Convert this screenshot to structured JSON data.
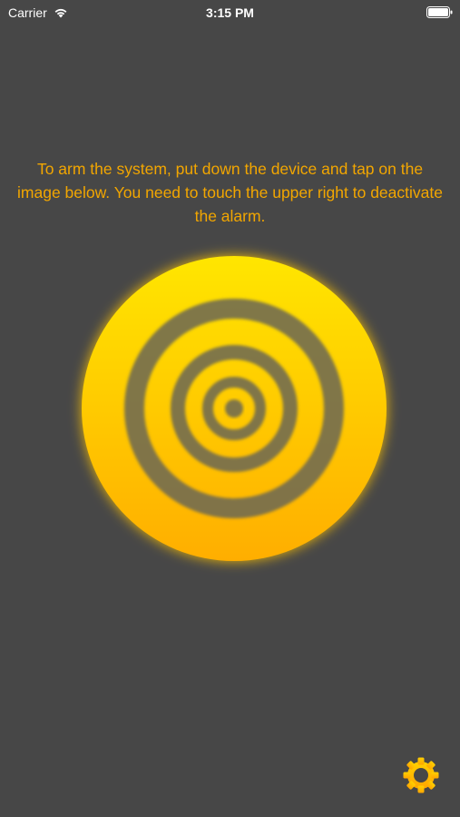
{
  "status_bar": {
    "carrier": "Carrier",
    "time": "3:15 PM",
    "wifi_icon": "wifi-icon",
    "battery_icon": "battery-icon"
  },
  "main": {
    "instructions": "To arm the system, put down the device and tap on the image below. You need to touch the upper right to deactivate the alarm.",
    "target_icon": "concentric-rings-target-icon",
    "settings_icon": "gear-icon"
  },
  "colors": {
    "background": "#474747",
    "accent": "#f2a600",
    "target_top": "#ffe600",
    "target_bottom": "#ffae00",
    "ring_gap": "#6e6a52"
  }
}
